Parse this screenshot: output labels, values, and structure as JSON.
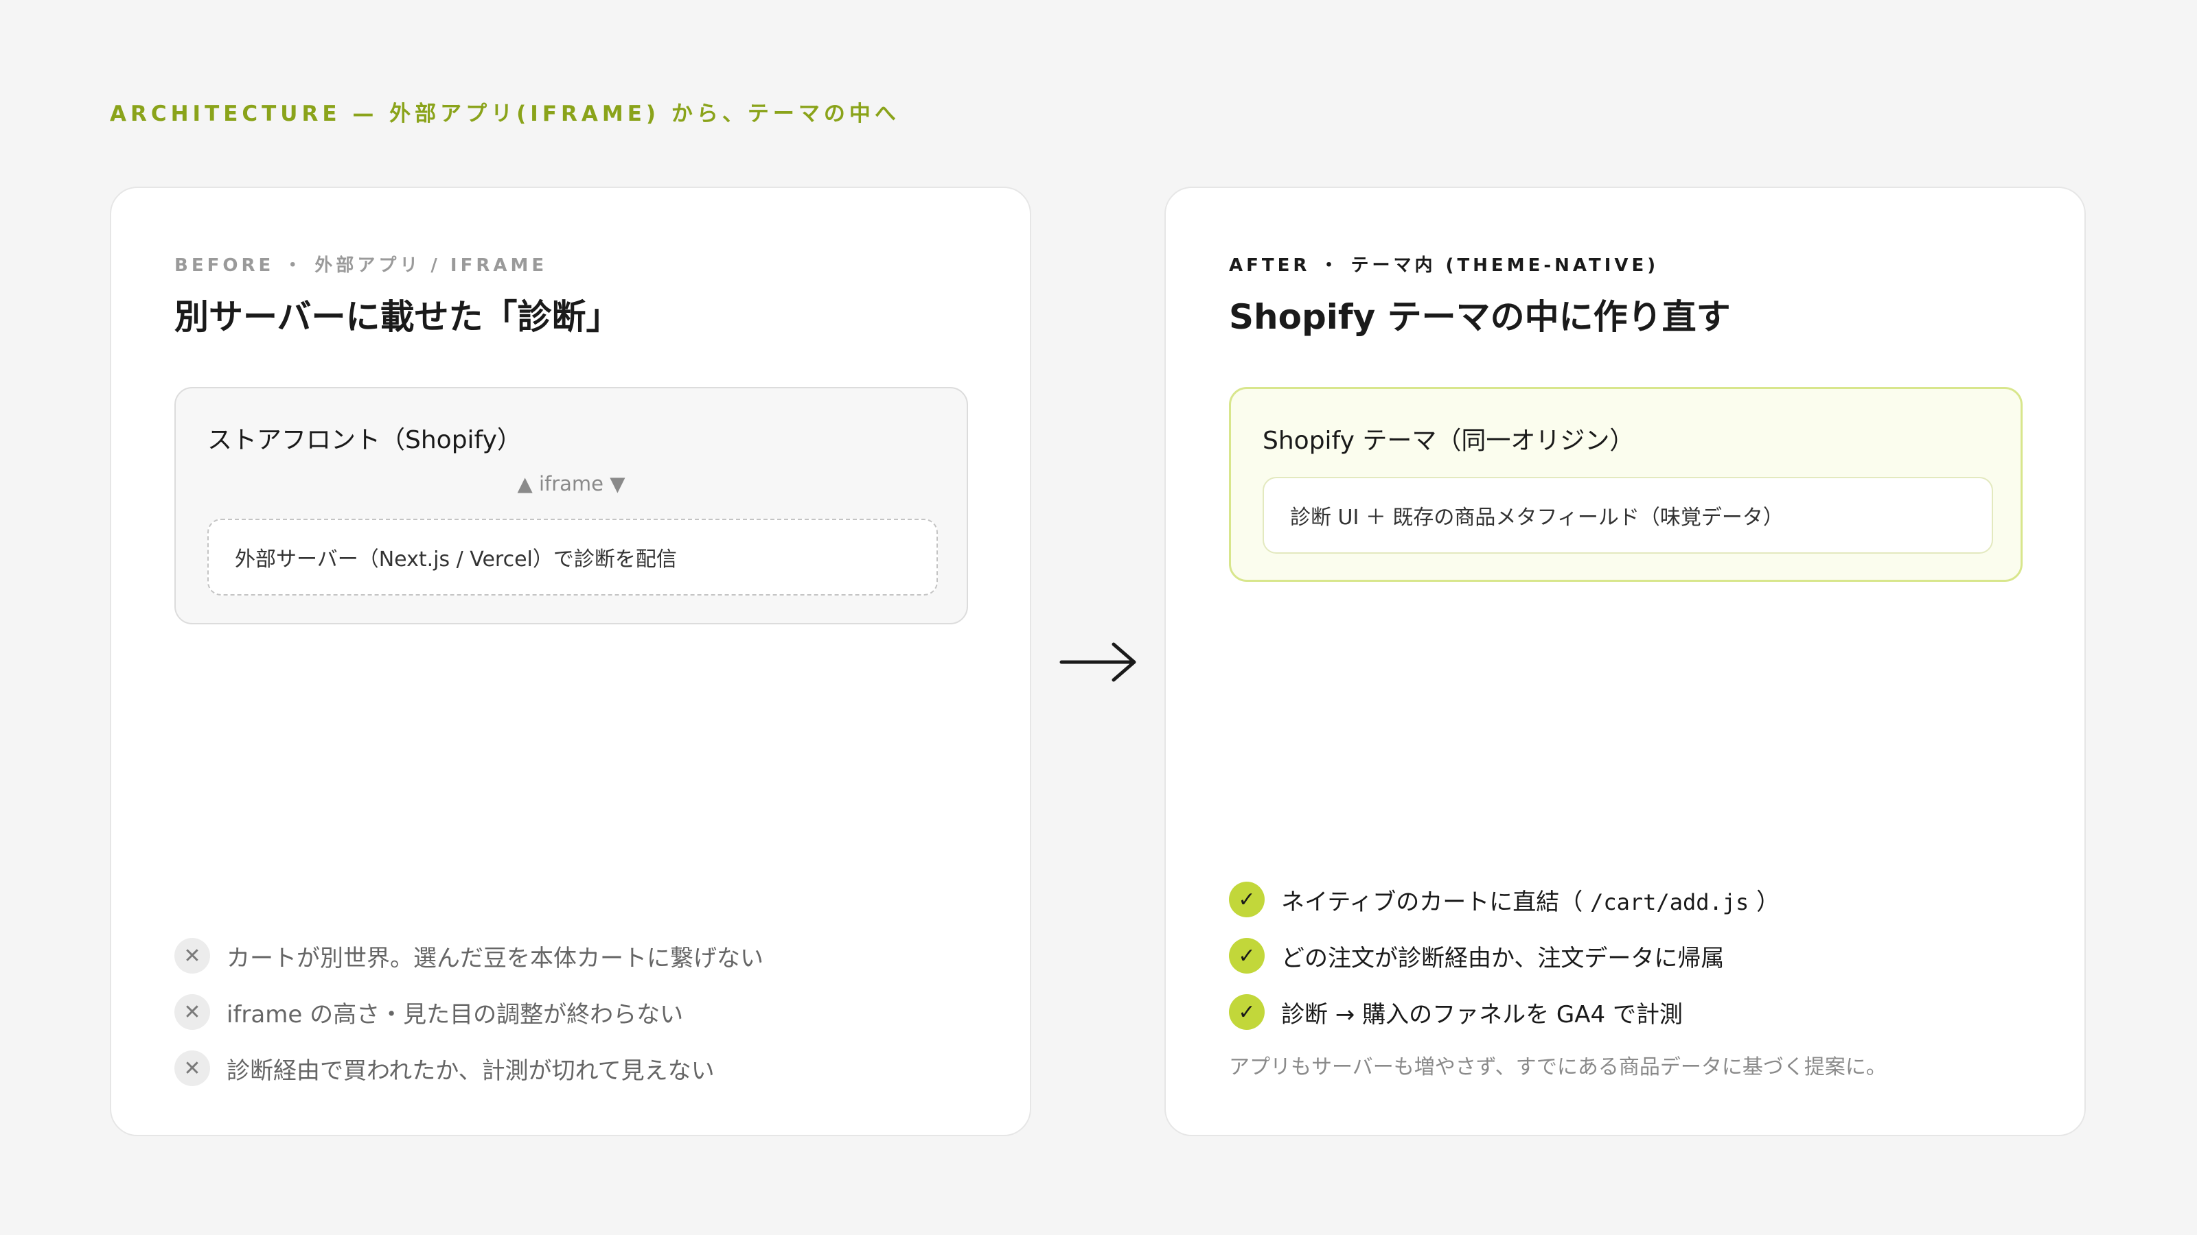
{
  "header": {
    "eyebrow": "ARCHITECTURE — 外部アプリ(IFRAME) から、テーマの中へ"
  },
  "before": {
    "tag": "BEFORE ・ 外部アプリ / IFRAME",
    "title": "別サーバーに載せた「診断」",
    "box_title": "ストアフロント（Shopify）",
    "iframe_label": "▲ iframe ▼",
    "inner_label": "外部サーバー（Next.js / Vercel）で診断を配信",
    "issues": [
      "カートが別世界。選んだ豆を本体カートに繋げない",
      "iframe の高さ・見た目の調整が終わらない",
      "診断経由で買われたか、計測が切れて見えない"
    ]
  },
  "after": {
    "tag": "AFTER ・ テーマ内 (THEME-NATIVE)",
    "title": "Shopify テーマの中に作り直す",
    "box_title": "Shopify テーマ（同一オリジン）",
    "inner_label": "診断 UI ＋ 既存の商品メタフィールド（味覚データ）",
    "benefits": [
      {
        "pre": "ネイティブのカートに直結（ ",
        "code": "/cart/add.js",
        "post": " ）"
      },
      {
        "pre": "どの注文が診断経由か、注文データに帰属",
        "code": "",
        "post": ""
      },
      {
        "pre": "診断 → 購入のファネルを GA4 で計測",
        "code": "",
        "post": ""
      }
    ],
    "footnote": "アプリもサーバーも増やさず、すでにある商品データに基づく提案に。"
  },
  "icons": {
    "issue": "close-icon",
    "benefit": "check-icon",
    "transition": "arrow-right-icon"
  },
  "colors": {
    "accent": "#8aa31a",
    "check": "#c2d73a",
    "after_box_border": "#d8e68c",
    "after_box_bg": "#fbfdee"
  }
}
